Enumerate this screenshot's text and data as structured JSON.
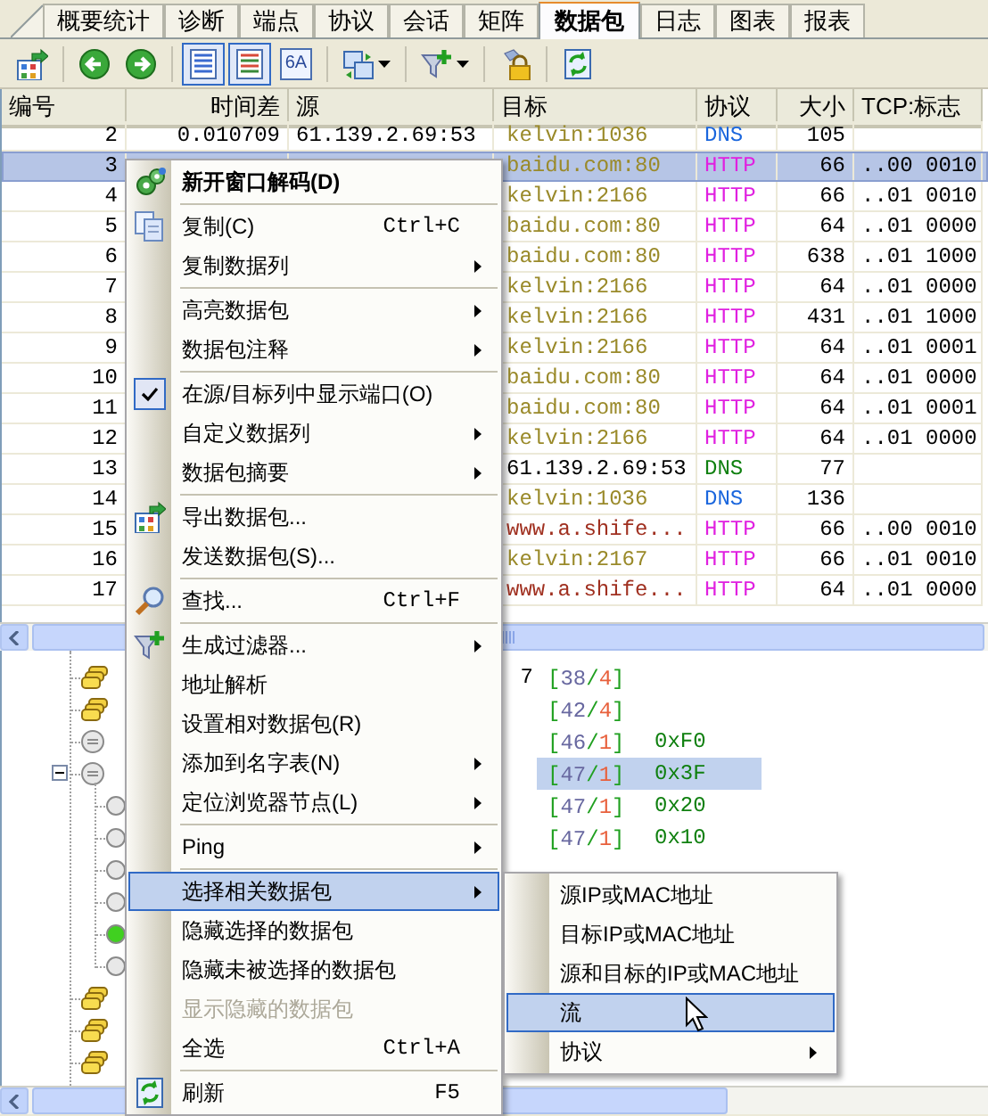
{
  "tabs": [
    {
      "label": "概要统计",
      "selected": false
    },
    {
      "label": "诊断",
      "selected": false
    },
    {
      "label": "端点",
      "selected": false
    },
    {
      "label": "协议",
      "selected": false
    },
    {
      "label": "会话",
      "selected": false
    },
    {
      "label": "矩阵",
      "selected": false
    },
    {
      "label": "数据包",
      "selected": true
    },
    {
      "label": "日志",
      "selected": false
    },
    {
      "label": "图表",
      "selected": false
    },
    {
      "label": "报表",
      "selected": false
    }
  ],
  "toolbar": [
    {
      "kind": "button",
      "pressed": false,
      "dropdown": false
    },
    {
      "kind": "separator"
    },
    {
      "kind": "button",
      "pressed": false,
      "dropdown": false
    },
    {
      "kind": "button",
      "pressed": false,
      "dropdown": false
    },
    {
      "kind": "separator"
    },
    {
      "kind": "button",
      "pressed": true,
      "dropdown": false
    },
    {
      "kind": "button",
      "pressed": true,
      "dropdown": false
    },
    {
      "kind": "button",
      "pressed": false,
      "dropdown": false,
      "label": "6A"
    },
    {
      "kind": "separator"
    },
    {
      "kind": "button",
      "pressed": false,
      "dropdown": true
    },
    {
      "kind": "separator"
    },
    {
      "kind": "button",
      "pressed": false,
      "dropdown": true
    },
    {
      "kind": "separator"
    },
    {
      "kind": "button",
      "pressed": false,
      "dropdown": false
    },
    {
      "kind": "separator"
    },
    {
      "kind": "button",
      "pressed": false,
      "dropdown": false
    }
  ],
  "packets": {
    "columns": [
      "编号",
      "时间差",
      "源",
      "目标",
      "协议",
      "大小",
      "TCP:标志"
    ],
    "rows": [
      {
        "number": "2",
        "time": "0.010709",
        "source": "61.139.2.69:53",
        "destination": {
          "text": "kelvin:1036",
          "color": "#9a8a2a"
        },
        "protocol": {
          "text": "DNS",
          "color": "#1a66dd"
        },
        "size": "105",
        "selected": false
      },
      {
        "number": "3",
        "destination": {
          "text": "baidu.com:80",
          "color": "#9a8a2a"
        },
        "protocol": {
          "text": "HTTP",
          "color": "#e020e0"
        },
        "size": "66",
        "tcp_flags": "..00 0010",
        "selected": true
      },
      {
        "number": "4",
        "destination": {
          "text": "kelvin:2166",
          "color": "#9a8a2a"
        },
        "protocol": {
          "text": "HTTP",
          "color": "#e020e0"
        },
        "size": "66",
        "tcp_flags": "..01 0010",
        "selected": false
      },
      {
        "number": "5",
        "destination": {
          "text": "baidu.com:80",
          "color": "#9a8a2a"
        },
        "protocol": {
          "text": "HTTP",
          "color": "#e020e0"
        },
        "size": "64",
        "tcp_flags": "..01 0000",
        "selected": false
      },
      {
        "number": "6",
        "destination": {
          "text": "baidu.com:80",
          "color": "#9a8a2a"
        },
        "protocol": {
          "text": "HTTP",
          "color": "#e020e0"
        },
        "size": "638",
        "tcp_flags": "..01 1000",
        "selected": false
      },
      {
        "number": "7",
        "destination": {
          "text": "kelvin:2166",
          "color": "#9a8a2a"
        },
        "protocol": {
          "text": "HTTP",
          "color": "#e020e0"
        },
        "size": "64",
        "tcp_flags": "..01 0000",
        "selected": false
      },
      {
        "number": "8",
        "destination": {
          "text": "kelvin:2166",
          "color": "#9a8a2a"
        },
        "protocol": {
          "text": "HTTP",
          "color": "#e020e0"
        },
        "size": "431",
        "tcp_flags": "..01 1000",
        "selected": false
      },
      {
        "number": "9",
        "destination": {
          "text": "kelvin:2166",
          "color": "#9a8a2a"
        },
        "protocol": {
          "text": "HTTP",
          "color": "#e020e0"
        },
        "size": "64",
        "tcp_flags": "..01 0001",
        "selected": false
      },
      {
        "number": "10",
        "destination": {
          "text": "baidu.com:80",
          "color": "#9a8a2a"
        },
        "protocol": {
          "text": "HTTP",
          "color": "#e020e0"
        },
        "size": "64",
        "tcp_flags": "..01 0000",
        "selected": false
      },
      {
        "number": "11",
        "destination": {
          "text": "baidu.com:80",
          "color": "#9a8a2a"
        },
        "protocol": {
          "text": "HTTP",
          "color": "#e020e0"
        },
        "size": "64",
        "tcp_flags": "..01 0001",
        "selected": false
      },
      {
        "number": "12",
        "destination": {
          "text": "kelvin:2166",
          "color": "#9a8a2a"
        },
        "protocol": {
          "text": "HTTP",
          "color": "#e020e0"
        },
        "size": "64",
        "tcp_flags": "..01 0000",
        "selected": false
      },
      {
        "number": "13",
        "destination": {
          "text": "61.139.2.69:53",
          "color": "#000000"
        },
        "protocol": {
          "text": "DNS",
          "color": "#108010"
        },
        "size": "77",
        "selected": false
      },
      {
        "number": "14",
        "destination": {
          "text": "kelvin:1036",
          "color": "#9a8a2a"
        },
        "protocol": {
          "text": "DNS",
          "color": "#1a66dd"
        },
        "size": "136",
        "selected": false
      },
      {
        "number": "15",
        "destination": {
          "text": "www.a.shife...",
          "color": "#a03020"
        },
        "protocol": {
          "text": "HTTP",
          "color": "#e020e0"
        },
        "size": "66",
        "tcp_flags": "..00 0010",
        "selected": false
      },
      {
        "number": "16",
        "destination": {
          "text": "kelvin:2167",
          "color": "#9a8a2a"
        },
        "protocol": {
          "text": "HTTP",
          "color": "#e020e0"
        },
        "size": "66",
        "tcp_flags": "..01 0010",
        "selected": false
      },
      {
        "number": "17",
        "destination": {
          "text": "www.a.shife...",
          "color": "#a03020"
        },
        "protocol": {
          "text": "HTTP",
          "color": "#e020e0"
        },
        "size": "64",
        "tcp_flags": "..01 0000",
        "selected": false
      }
    ]
  },
  "decode_tree": {
    "nodes": [
      {
        "kind": "group",
        "column_2": "7",
        "offset": "[38/4]",
        "selected": false
      },
      {
        "kind": "group",
        "offset": "[42/4]",
        "selected": false
      },
      {
        "kind": "field",
        "offset": "[46/1]",
        "value": "0xF0",
        "selected": false
      },
      {
        "kind": "field",
        "offset": "[47/1]",
        "value": "0x3F",
        "selected": true,
        "expanded": true,
        "children": [
          {
            "kind": "flag",
            "on": false,
            "offset": "[47/1]",
            "value": "0x20",
            "selected": false
          },
          {
            "kind": "flag",
            "on": false,
            "offset": "[47/1]",
            "value": "0x10",
            "selected": false
          },
          {
            "kind": "flag",
            "on": false
          },
          {
            "kind": "flag",
            "on": false
          },
          {
            "kind": "flag",
            "on": true
          },
          {
            "kind": "flag",
            "on": false
          }
        ]
      },
      {
        "kind": "group"
      },
      {
        "kind": "group"
      },
      {
        "kind": "group"
      }
    ]
  },
  "context_menu": {
    "items": [
      {
        "kind": "item",
        "label": "新开窗口解码(D)",
        "default": true,
        "checked": false,
        "disabled": false,
        "selected": false,
        "has_submenu": false
      },
      {
        "kind": "separator"
      },
      {
        "kind": "item",
        "label": "复制(C)",
        "shortcut": "Ctrl+C",
        "default": false,
        "checked": false,
        "disabled": false,
        "selected": false,
        "has_submenu": false
      },
      {
        "kind": "item",
        "label": "复制数据列",
        "default": false,
        "checked": false,
        "disabled": false,
        "selected": false,
        "has_submenu": true
      },
      {
        "kind": "separator"
      },
      {
        "kind": "item",
        "label": "高亮数据包",
        "default": false,
        "checked": false,
        "disabled": false,
        "selected": false,
        "has_submenu": true
      },
      {
        "kind": "item",
        "label": "数据包注释",
        "default": false,
        "checked": false,
        "disabled": false,
        "selected": false,
        "has_submenu": true
      },
      {
        "kind": "separator"
      },
      {
        "kind": "item",
        "label": "在源/目标列中显示端口(O)",
        "default": false,
        "checked": true,
        "disabled": false,
        "selected": false,
        "has_submenu": false
      },
      {
        "kind": "item",
        "label": "自定义数据列",
        "default": false,
        "checked": false,
        "disabled": false,
        "selected": false,
        "has_submenu": true
      },
      {
        "kind": "item",
        "label": "数据包摘要",
        "default": false,
        "checked": false,
        "disabled": false,
        "selected": false,
        "has_submenu": true
      },
      {
        "kind": "separator"
      },
      {
        "kind": "item",
        "label": "导出数据包...",
        "default": false,
        "checked": false,
        "disabled": false,
        "selected": false,
        "has_submenu": false
      },
      {
        "kind": "item",
        "label": "发送数据包(S)...",
        "default": false,
        "checked": false,
        "disabled": false,
        "selected": false,
        "has_submenu": false
      },
      {
        "kind": "separator"
      },
      {
        "kind": "item",
        "label": "查找...",
        "shortcut": "Ctrl+F",
        "default": false,
        "checked": false,
        "disabled": false,
        "selected": false,
        "has_submenu": false
      },
      {
        "kind": "separator"
      },
      {
        "kind": "item",
        "label": "生成过滤器...",
        "default": false,
        "checked": false,
        "disabled": false,
        "selected": false,
        "has_submenu": true
      },
      {
        "kind": "item",
        "label": "地址解析",
        "default": false,
        "checked": false,
        "disabled": false,
        "selected": false,
        "has_submenu": false
      },
      {
        "kind": "item",
        "label": "设置相对数据包(R)",
        "default": false,
        "checked": false,
        "disabled": false,
        "selected": false,
        "has_submenu": false
      },
      {
        "kind": "item",
        "label": "添加到名字表(N)",
        "default": false,
        "checked": false,
        "disabled": false,
        "selected": false,
        "has_submenu": true
      },
      {
        "kind": "item",
        "label": "定位浏览器节点(L)",
        "default": false,
        "checked": false,
        "disabled": false,
        "selected": false,
        "has_submenu": true
      },
      {
        "kind": "separator"
      },
      {
        "kind": "item",
        "label": "Ping",
        "default": false,
        "checked": false,
        "disabled": false,
        "selected": false,
        "has_submenu": true
      },
      {
        "kind": "separator"
      },
      {
        "kind": "item",
        "label": "选择相关数据包",
        "default": false,
        "checked": false,
        "disabled": false,
        "selected": true,
        "has_submenu": true
      },
      {
        "kind": "item",
        "label": "隐藏选择的数据包",
        "default": false,
        "checked": false,
        "disabled": false,
        "selected": false,
        "has_submenu": false
      },
      {
        "kind": "item",
        "label": "隐藏未被选择的数据包",
        "default": false,
        "checked": false,
        "disabled": false,
        "selected": false,
        "has_submenu": false
      },
      {
        "kind": "item",
        "label": "显示隐藏的数据包",
        "default": false,
        "checked": false,
        "disabled": true,
        "selected": false,
        "has_submenu": false
      },
      {
        "kind": "item",
        "label": "全选",
        "shortcut": "Ctrl+A",
        "default": false,
        "checked": false,
        "disabled": false,
        "selected": false,
        "has_submenu": false
      },
      {
        "kind": "separator"
      },
      {
        "kind": "item",
        "label": "刷新",
        "shortcut": "F5",
        "default": false,
        "checked": false,
        "disabled": false,
        "selected": false,
        "has_submenu": false
      }
    ]
  },
  "submenu": {
    "items": [
      {
        "label": "源IP或MAC地址",
        "selected": false,
        "has_submenu": false
      },
      {
        "label": "目标IP或MAC地址",
        "selected": false,
        "has_submenu": false
      },
      {
        "label": "源和目标的IP或MAC地址",
        "selected": false,
        "has_submenu": false
      },
      {
        "label": "流",
        "selected": true,
        "has_submenu": false
      },
      {
        "label": "协议",
        "selected": false,
        "has_submenu": true
      }
    ]
  }
}
